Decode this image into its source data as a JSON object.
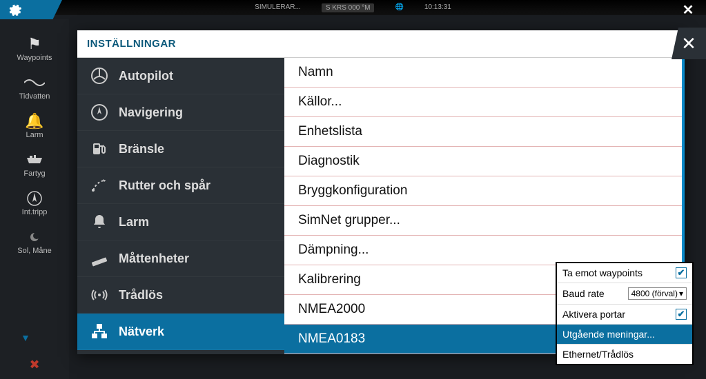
{
  "statusbar": {
    "simulating": "SIMULERAR...",
    "kurs_label": "S",
    "kurs_value": "KRS 000 °M",
    "time": "10:13:31"
  },
  "leftbar": {
    "items": [
      {
        "label": "Waypoints"
      },
      {
        "label": "Tidvatten"
      },
      {
        "label": "Larm"
      },
      {
        "label": "Fartyg"
      },
      {
        "label": "Int.tripp"
      },
      {
        "label": "Sol, Måne"
      }
    ]
  },
  "dialog": {
    "title": "INSTÄLLNINGAR"
  },
  "sidebar": {
    "items": [
      {
        "label": "Autopilot"
      },
      {
        "label": "Navigering"
      },
      {
        "label": "Bränsle"
      },
      {
        "label": "Rutter och spår"
      },
      {
        "label": "Larm"
      },
      {
        "label": "Måttenheter"
      },
      {
        "label": "Trådlös"
      },
      {
        "label": "Nätverk"
      }
    ]
  },
  "content": {
    "items": [
      "Namn",
      "Källor...",
      "Enhetslista",
      "Diagnostik",
      "Bryggkonfiguration",
      "SimNet grupper...",
      "Dämpning...",
      "Kalibrering",
      "NMEA2000",
      "NMEA0183"
    ]
  },
  "popup": {
    "items": [
      {
        "label": "Ta emot waypoints"
      },
      {
        "label": "Baud rate"
      },
      {
        "label": "Aktivera portar"
      },
      {
        "label": "Utgående meningar..."
      },
      {
        "label": "Ethernet/Trådlös"
      }
    ],
    "baud_value": "4800 (förval)"
  }
}
